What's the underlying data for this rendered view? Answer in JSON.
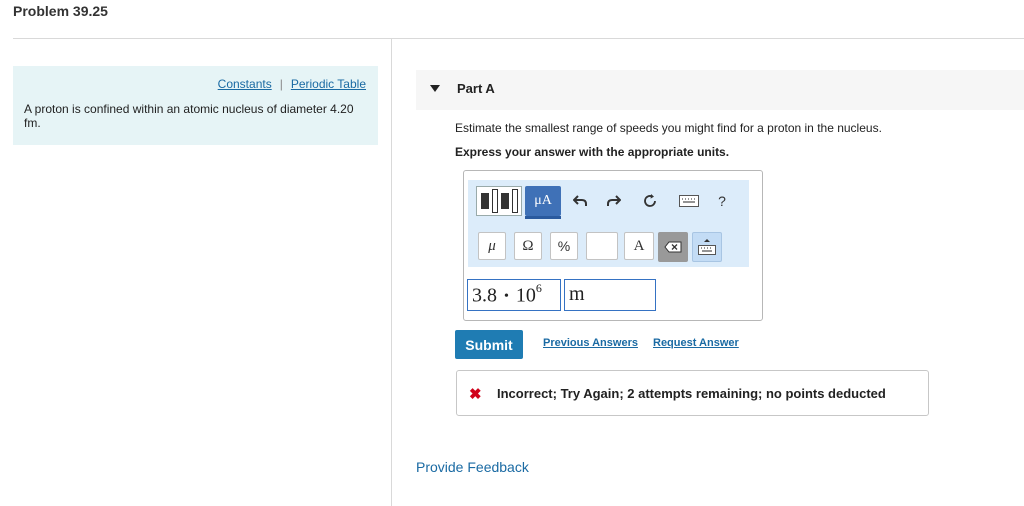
{
  "problem": {
    "title": "Problem 39.25"
  },
  "sidebar": {
    "links": [
      "Constants",
      "Periodic Table"
    ],
    "separator": "|",
    "text": "A proton is confined within an atomic nucleus of diameter 4.20 fm."
  },
  "part": {
    "title": "Part A",
    "question": "Estimate the smallest range of speeds you might find for a proton in the nucleus.",
    "instruction": "Express your answer with the appropriate units."
  },
  "toolbar": {
    "units_button_label": "μA",
    "help_label": "?",
    "mu_label": "μ",
    "omega_label": "Ω",
    "percent_label": "%",
    "a_label": "A",
    "icons": [
      "template-icon",
      "undo-icon",
      "redo-icon",
      "reset-icon",
      "keyboard-icon",
      "help-icon",
      "delete-icon",
      "keyboard-toggle-icon"
    ]
  },
  "answer": {
    "mantissa": "3.8",
    "dot": "•",
    "base": "10",
    "exponent": "6",
    "unit": "m"
  },
  "actions": {
    "submit_label": "Submit",
    "previous_answers_label": "Previous Answers",
    "request_answer_label": "Request Answer"
  },
  "feedback": {
    "icon": "✖",
    "message": "Incorrect; Try Again; 2 attempts remaining; no points deducted"
  },
  "footer": {
    "provide_feedback_label": "Provide Feedback"
  },
  "colors": {
    "accent": "#1f7cb3",
    "link": "#1a6aa3",
    "error": "#d0021b",
    "sidebar_bg": "#e6f4f6",
    "toolbar_bg": "#dcecfa"
  }
}
